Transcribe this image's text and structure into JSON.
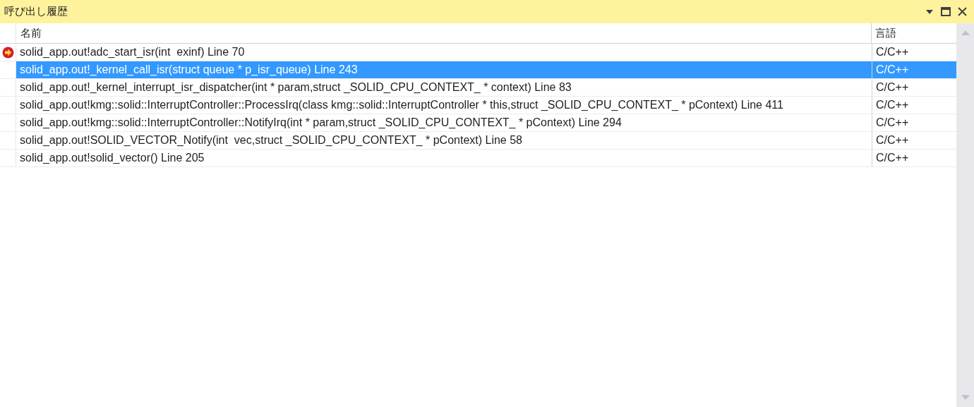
{
  "window": {
    "title": "呼び出し履歴"
  },
  "table": {
    "columns": [
      "名前",
      "言語"
    ],
    "rows": [
      {
        "name": "solid_app.out!adc_start_isr(int  exinf) Line 70",
        "language": "C/C++",
        "current": true,
        "selected": false
      },
      {
        "name": "solid_app.out!_kernel_call_isr(struct queue * p_isr_queue) Line 243",
        "language": "C/C++",
        "current": false,
        "selected": true
      },
      {
        "name": "solid_app.out!_kernel_interrupt_isr_dispatcher(int * param,struct _SOLID_CPU_CONTEXT_ * context) Line 83",
        "language": "C/C++",
        "current": false,
        "selected": false
      },
      {
        "name": "solid_app.out!kmg::solid::InterruptController::ProcessIrq(class kmg::solid::InterruptController * this,struct _SOLID_CPU_CONTEXT_ * pContext) Line 411",
        "language": "C/C++",
        "current": false,
        "selected": false
      },
      {
        "name": "solid_app.out!kmg::solid::InterruptController::NotifyIrq(int * param,struct _SOLID_CPU_CONTEXT_ * pContext) Line 294",
        "language": "C/C++",
        "current": false,
        "selected": false
      },
      {
        "name": "solid_app.out!SOLID_VECTOR_Notify(int  vec,struct _SOLID_CPU_CONTEXT_ * pContext) Line 58",
        "language": "C/C++",
        "current": false,
        "selected": false
      },
      {
        "name": "solid_app.out!solid_vector() Line 205",
        "language": "C/C++",
        "current": false,
        "selected": false
      }
    ]
  }
}
